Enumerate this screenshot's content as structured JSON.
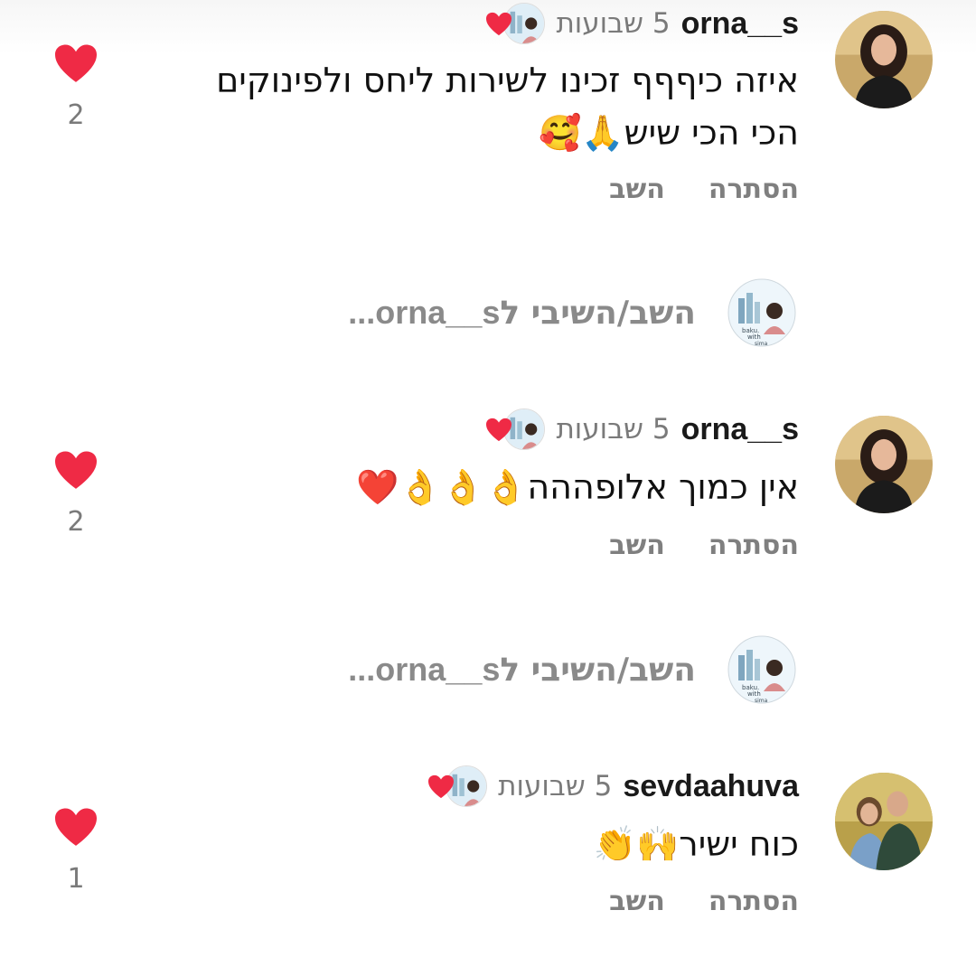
{
  "colors": {
    "heart": "#ef2a45",
    "muted": "#7a7a7a"
  },
  "comments": [
    {
      "username": "orna__s",
      "time": "5 שבועות",
      "text_line1": "איזה כיףףף זכינו לשירות ליחס ולפינוקים",
      "text_line2": "הכי הכי שיש🙏🥰",
      "reply_label": "השב",
      "hide_label": "הסתרה",
      "likes": "2",
      "liked_by_author": true,
      "avatar_icon": "woman-portrait-icon"
    },
    {
      "username": "orna__s",
      "time": "5 שבועות",
      "text_line1": "אין כמוך אלופההה👌👌👌❤️",
      "reply_label": "השב",
      "hide_label": "הסתרה",
      "likes": "2",
      "liked_by_author": true,
      "avatar_icon": "woman-portrait-icon"
    },
    {
      "username": "sevdaahuva",
      "time": "5 שבועות",
      "text_line1": "כוח ישיר🙌👏",
      "reply_label": "השב",
      "hide_label": "הסתרה",
      "likes": "1",
      "liked_by_author": true,
      "avatar_icon": "couple-portrait-icon"
    }
  ],
  "reply_prompts": [
    {
      "text": "השב/השיבי ל",
      "username": "orna__s..."
    },
    {
      "text": "השב/השיבי ל",
      "username": "orna__s..."
    }
  ],
  "author_avatar_text": [
    "baku.",
    "with",
    "sima"
  ]
}
